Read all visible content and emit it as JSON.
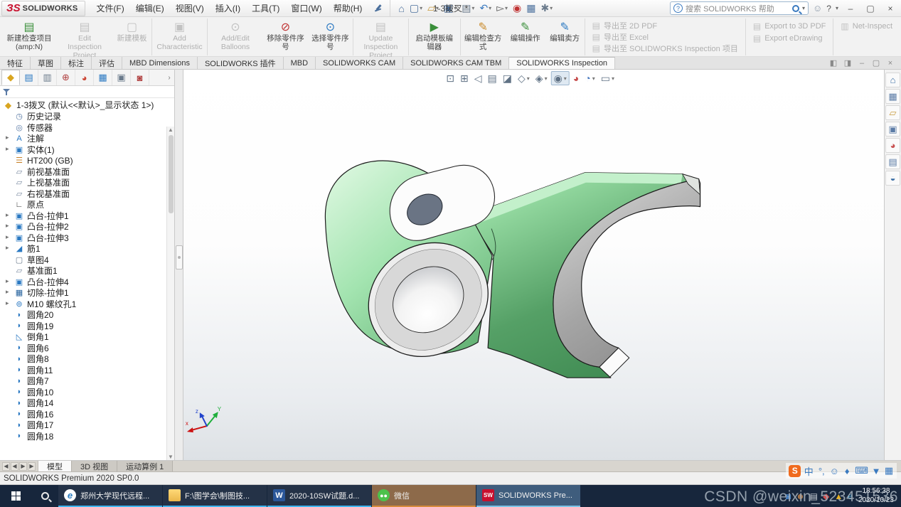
{
  "titlebar": {
    "logo_ds": "ЗS",
    "logo_name": "SOLIDWORKS",
    "menus": [
      "文件(F)",
      "编辑(E)",
      "视图(V)",
      "插入(I)",
      "工具(T)",
      "窗口(W)",
      "帮助(H)"
    ],
    "quick_icons": [
      {
        "name": "home-icon",
        "dropdown": false
      },
      {
        "name": "new-document-icon",
        "dropdown": true
      },
      {
        "name": "open-icon",
        "dropdown": true
      },
      {
        "name": "save-icon",
        "dropdown": true
      },
      {
        "name": "print-icon",
        "dropdown": true
      },
      {
        "name": "undo-icon",
        "dropdown": true
      },
      {
        "name": "select-cursor-icon",
        "dropdown": true
      },
      {
        "name": "performance-pipeline-icon",
        "dropdown": false
      },
      {
        "name": "evaluate-icon",
        "dropdown": false
      },
      {
        "name": "options-gear-icon",
        "dropdown": true
      }
    ],
    "doc_title": "1-3拨叉 *",
    "search_placeholder": "搜索 SOLIDWORKS 帮助",
    "help_label": "?"
  },
  "ribbon": {
    "buttons": [
      {
        "label": "新建检查项目(amp:N)",
        "icon": "new-inspection-project-icon"
      },
      {
        "label": "Edit Inspection Project",
        "icon": "edit-inspection-project-icon",
        "disabled": true
      },
      {
        "label": "新建模板",
        "icon": "new-template-icon",
        "disabled": true,
        "sep": true
      },
      {
        "label": "Add Characteristic",
        "icon": "add-characteristic-icon",
        "disabled": true,
        "sep": true
      },
      {
        "label": "Add/Edit Balloons",
        "icon": "add-edit-balloons-icon",
        "disabled": true
      },
      {
        "label": "移除零件序号",
        "icon": "remove-balloons-icon"
      },
      {
        "label": "选择零件序号",
        "icon": "select-balloons-icon",
        "sep": true
      },
      {
        "label": "Update Inspection Project",
        "icon": "update-inspection-project-icon",
        "disabled": true,
        "sep": true
      },
      {
        "label": "启动模板编辑器",
        "icon": "template-editor-icon",
        "sep": true
      },
      {
        "label": "编辑检查方式",
        "icon": "edit-inspection-method-icon"
      },
      {
        "label": "编辑操作",
        "icon": "edit-operation-icon"
      },
      {
        "label": "编辑卖方",
        "icon": "edit-vendor-icon",
        "sep": true
      }
    ],
    "export_col1": [
      {
        "label": "导出至 2D PDF",
        "icon": "export-2d-pdf-icon",
        "disabled": true
      },
      {
        "label": "导出至 Excel",
        "icon": "export-excel-icon",
        "disabled": true
      },
      {
        "label": "导出至 SOLIDWORKS Inspection 项目",
        "icon": "export-sw-inspection-icon",
        "disabled": true
      }
    ],
    "export_col2": [
      {
        "label": "Export to 3D PDF",
        "icon": "export-3d-pdf-icon",
        "disabled": true
      },
      {
        "label": "Export eDrawing",
        "icon": "export-edrawing-icon",
        "disabled": true
      }
    ],
    "export_col3": [
      {
        "label": "Net-Inspect",
        "icon": "net-inspect-icon",
        "disabled": true
      }
    ]
  },
  "command_tabs": [
    {
      "label": "特征"
    },
    {
      "label": "草图"
    },
    {
      "label": "标注"
    },
    {
      "label": "评估"
    },
    {
      "label": "MBD Dimensions"
    },
    {
      "label": "SOLIDWORKS 插件"
    },
    {
      "label": "MBD"
    },
    {
      "label": "SOLIDWORKS CAM"
    },
    {
      "label": "SOLIDWORKS CAM TBM"
    },
    {
      "label": "SOLIDWORKS Inspection",
      "active": true
    }
  ],
  "feature_tree": {
    "tabs": [
      {
        "name": "featuremanager-tab",
        "active": true
      },
      {
        "name": "propertymanager-tab"
      },
      {
        "name": "configurationmanager-tab"
      },
      {
        "name": "dimxpertmanager-tab"
      },
      {
        "name": "displaymanager-tab"
      },
      {
        "name": "cam-feature-tree-tab"
      },
      {
        "name": "cam-operation-tree-tab"
      },
      {
        "name": "inspection-manager-tab"
      }
    ],
    "root": {
      "label": "1-3拨叉 (默认<<默认>_显示状态 1>)",
      "icon": "part-icon"
    },
    "items": [
      {
        "label": "历史记录",
        "icon": "history-folder-icon"
      },
      {
        "label": "传感器",
        "icon": "sensors-icon"
      },
      {
        "label": "注解",
        "icon": "annotations-icon",
        "caret": true
      },
      {
        "label": "实体(1)",
        "icon": "solid-bodies-icon",
        "caret": true
      },
      {
        "label": "HT200 (GB)",
        "icon": "material-icon"
      },
      {
        "label": "前视基准面",
        "icon": "plane-icon"
      },
      {
        "label": "上视基准面",
        "icon": "plane-icon"
      },
      {
        "label": "右视基准面",
        "icon": "plane-icon"
      },
      {
        "label": "原点",
        "icon": "origin-icon"
      },
      {
        "label": "凸台-拉伸1",
        "icon": "boss-extrude-icon",
        "caret": true
      },
      {
        "label": "凸台-拉伸2",
        "icon": "boss-extrude-icon",
        "caret": true
      },
      {
        "label": "凸台-拉伸3",
        "icon": "boss-extrude-icon",
        "caret": true
      },
      {
        "label": "筋1",
        "icon": "rib-icon",
        "caret": true
      },
      {
        "label": "草图4",
        "icon": "sketch-icon"
      },
      {
        "label": "基准面1",
        "icon": "plane-icon"
      },
      {
        "label": "凸台-拉伸4",
        "icon": "boss-extrude-icon",
        "caret": true
      },
      {
        "label": "切除-拉伸1",
        "icon": "cut-extrude-icon",
        "caret": true
      },
      {
        "label": "M10 螺纹孔1",
        "icon": "tapped-hole-icon",
        "caret": true
      },
      {
        "label": "圆角20",
        "icon": "fillet-icon"
      },
      {
        "label": "圆角19",
        "icon": "fillet-icon"
      },
      {
        "label": "倒角1",
        "icon": "chamfer-icon"
      },
      {
        "label": "圆角6",
        "icon": "fillet-icon"
      },
      {
        "label": "圆角8",
        "icon": "fillet-icon"
      },
      {
        "label": "圆角11",
        "icon": "fillet-icon"
      },
      {
        "label": "圆角7",
        "icon": "fillet-icon"
      },
      {
        "label": "圆角10",
        "icon": "fillet-icon"
      },
      {
        "label": "圆角14",
        "icon": "fillet-icon"
      },
      {
        "label": "圆角16",
        "icon": "fillet-icon"
      },
      {
        "label": "圆角17",
        "icon": "fillet-icon"
      },
      {
        "label": "圆角18",
        "icon": "fillet-icon"
      }
    ]
  },
  "viewport": {
    "hud_icons": [
      {
        "name": "zoom-fit-icon"
      },
      {
        "name": "zoom-area-icon"
      },
      {
        "name": "previous-view-icon"
      },
      {
        "name": "section-view-icon"
      },
      {
        "name": "dynamic-annotation-views-icon"
      },
      {
        "name": "view-orientation-icon",
        "dropdown": true
      },
      {
        "name": "display-style-icon",
        "dropdown": true
      },
      {
        "name": "hide-show-items-icon",
        "dropdown": true,
        "pressed": true
      },
      {
        "name": "edit-appearance-icon"
      },
      {
        "name": "apply-scene-icon",
        "dropdown": true
      },
      {
        "name": "view-settings-icon",
        "dropdown": true
      }
    ],
    "triad": {
      "x": "x",
      "y": "Y",
      "z": "z"
    },
    "part_colors": {
      "green_light": "#b9edc2",
      "green_mid": "#6cbf7d",
      "green_dark": "#3f8a52",
      "machined_gray": "#9a9a9a",
      "hole_slate": "#6a7484"
    }
  },
  "task_pane_icons": [
    {
      "name": "solidworks-resources-icon"
    },
    {
      "name": "design-library-icon"
    },
    {
      "name": "file-explorer-icon"
    },
    {
      "name": "view-palette-icon"
    },
    {
      "name": "appearances-scenes-icon"
    },
    {
      "name": "custom-properties-icon"
    },
    {
      "name": "solidworks-forum-icon"
    }
  ],
  "model_tabs": [
    {
      "label": "模型",
      "active": true
    },
    {
      "label": "3D 视图"
    },
    {
      "label": "运动算例 1"
    }
  ],
  "status_bar": {
    "text": "SOLIDWORKS Premium 2020 SP0.0"
  },
  "ime_bar": [
    {
      "name": "sogou-s-icon",
      "text": "S",
      "sogou": true
    },
    {
      "name": "cn-mode-icon",
      "text": "中"
    },
    {
      "name": "punctuation-icon",
      "text": "°,"
    },
    {
      "name": "emoji-icon",
      "text": "☺"
    },
    {
      "name": "voice-input-icon",
      "text": "♦"
    },
    {
      "name": "soft-keyboard-icon",
      "text": "⌨"
    },
    {
      "name": "skin-icon",
      "text": "▼"
    },
    {
      "name": "toolbox-icon",
      "text": "▦"
    }
  ],
  "taskbar": {
    "apps": [
      {
        "label": "郑州大学现代远程...",
        "icon": "ie-icon",
        "icon_text": "e"
      },
      {
        "label": "F:\\图学会\\制图技...",
        "icon": "folder-icon",
        "icon_text": ""
      },
      {
        "label": "2020-10SW试题.d...",
        "icon": "word-icon",
        "icon_text": "W"
      },
      {
        "label": "微信",
        "icon": "wechat-icon",
        "icon_text": "●●",
        "highlight": "tan"
      },
      {
        "label": "SOLIDWORKS Pre...",
        "icon": "solidworks-icon",
        "icon_text": "SW",
        "highlight": "blue"
      }
    ],
    "tray_icons": [
      {
        "name": "defender-icon",
        "glyph": "◙",
        "color": "#4a8ad0"
      },
      {
        "name": "user-agent-icon",
        "glyph": "☻",
        "color": "#b07a4a"
      },
      {
        "name": "printer-icon",
        "glyph": "▤",
        "color": "#c8ced4"
      },
      {
        "name": "sync-box-icon",
        "glyph": "◆",
        "color": "#d05050"
      },
      {
        "name": "alert-icon",
        "glyph": "▲",
        "color": "#e8b020"
      },
      {
        "name": "ie-tray-icon",
        "glyph": "e",
        "color": "#58b8e8"
      }
    ],
    "clock": {
      "time": "18:56:38",
      "date": "2020/10/23"
    }
  },
  "watermark": "CSDN @weixin_523451536"
}
